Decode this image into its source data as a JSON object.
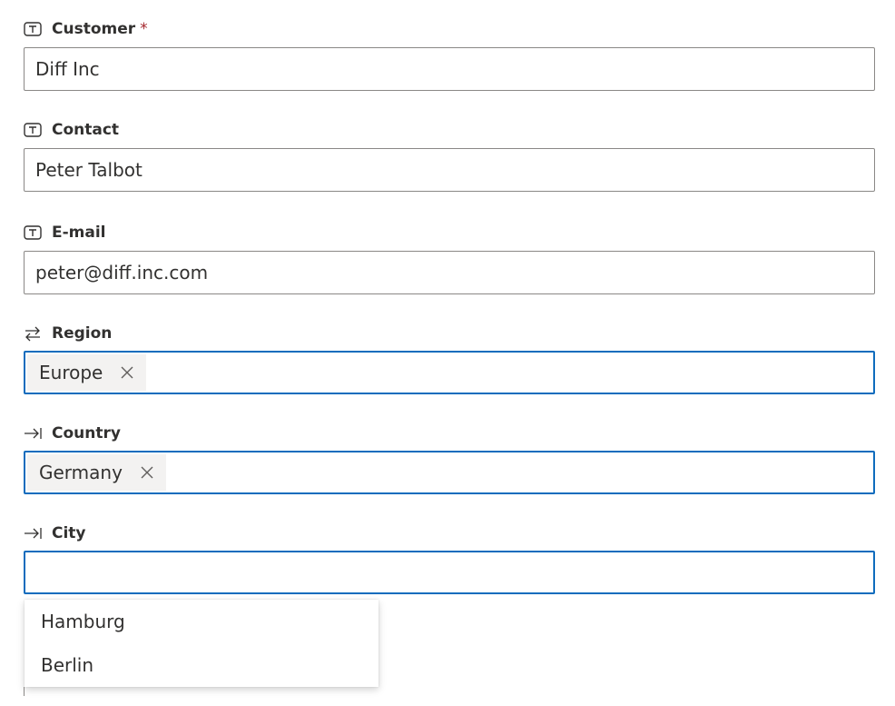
{
  "fields": {
    "customer": {
      "label": "Customer",
      "required_mark": "*",
      "value": "Diff Inc",
      "icon": "text-field-icon"
    },
    "contact": {
      "label": "Contact",
      "value": "Peter Talbot",
      "icon": "text-field-icon"
    },
    "email": {
      "label": "E-mail",
      "value": "peter@diff.inc.com",
      "icon": "text-field-icon"
    },
    "region": {
      "label": "Region",
      "tag": "Europe",
      "icon": "swap-arrows-icon"
    },
    "country": {
      "label": "Country",
      "tag": "Germany",
      "icon": "arrow-to-line-icon"
    },
    "city": {
      "label": "City",
      "value": "",
      "icon": "arrow-to-line-icon"
    }
  },
  "city_suggestions": [
    "Hamburg",
    "Berlin"
  ],
  "colors": {
    "focus_border": "#0f6cbd",
    "default_border": "#8a8886",
    "tag_background": "#f3f2f1",
    "required": "#a4262c"
  }
}
